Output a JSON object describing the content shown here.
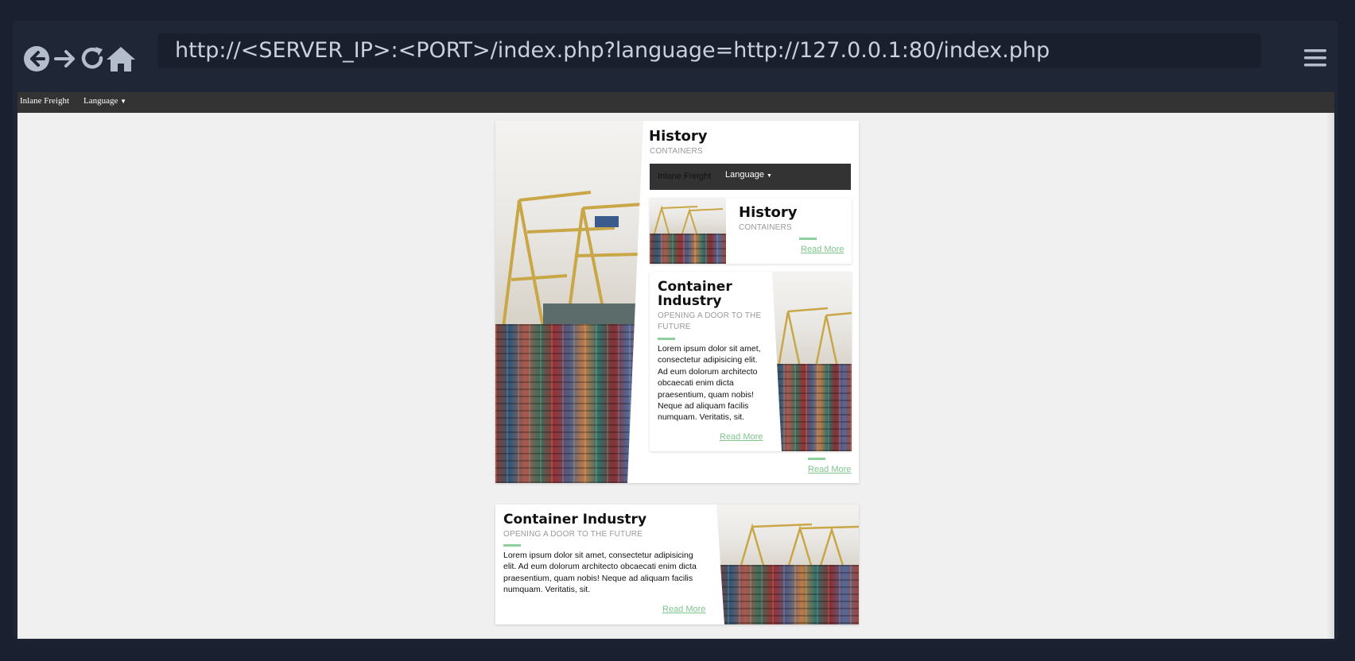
{
  "browser": {
    "url": "http://<SERVER_IP>:<PORT>/index.php?language=http://127.0.0.1:80/index.php",
    "icons": [
      "back-arrow-circle-icon",
      "forward-arrow-icon",
      "reload-icon",
      "home-icon",
      "hamburger-menu-icon"
    ]
  },
  "site_nav": {
    "brand": "Inlane Freight",
    "language": "Language"
  },
  "history_card": {
    "title": "History",
    "subtitle": "CONTAINERS",
    "inner_nav": {
      "brand": "Inlane Freight",
      "language": "Language"
    },
    "mini_card": {
      "title": "History",
      "subtitle": "CONTAINERS",
      "read_more": "Read More"
    },
    "industry_card": {
      "title_line1": "Container",
      "title_line2": "Industry",
      "subtitle_line1": "OPENING A DOOR TO THE",
      "subtitle_line2": "FUTURE",
      "body": "Lorem ipsum dolor sit amet, consectetur adipisicing elit. Ad eum dolorum architecto obcaecati enim dicta praesentium, quam nobis! Neque ad aliquam facilis numquam. Veritatis, sit.",
      "read_more": "Read More"
    },
    "read_more": "Read More"
  },
  "industry_card": {
    "title": "Container Industry",
    "subtitle": "OPENING A DOOR TO THE FUTURE",
    "body": "Lorem ipsum dolor sit amet, consectetur adipisicing elit. Ad eum dolorum architecto obcaecati enim dicta praesentium, quam nobis! Neque ad aliquam facilis numquam. Veritatis, sit.",
    "read_more": "Read More"
  },
  "colors": {
    "accent": "#8fcf9b",
    "link": "#7fc48d",
    "navbar": "#333333",
    "chrome": "#1f2636"
  }
}
